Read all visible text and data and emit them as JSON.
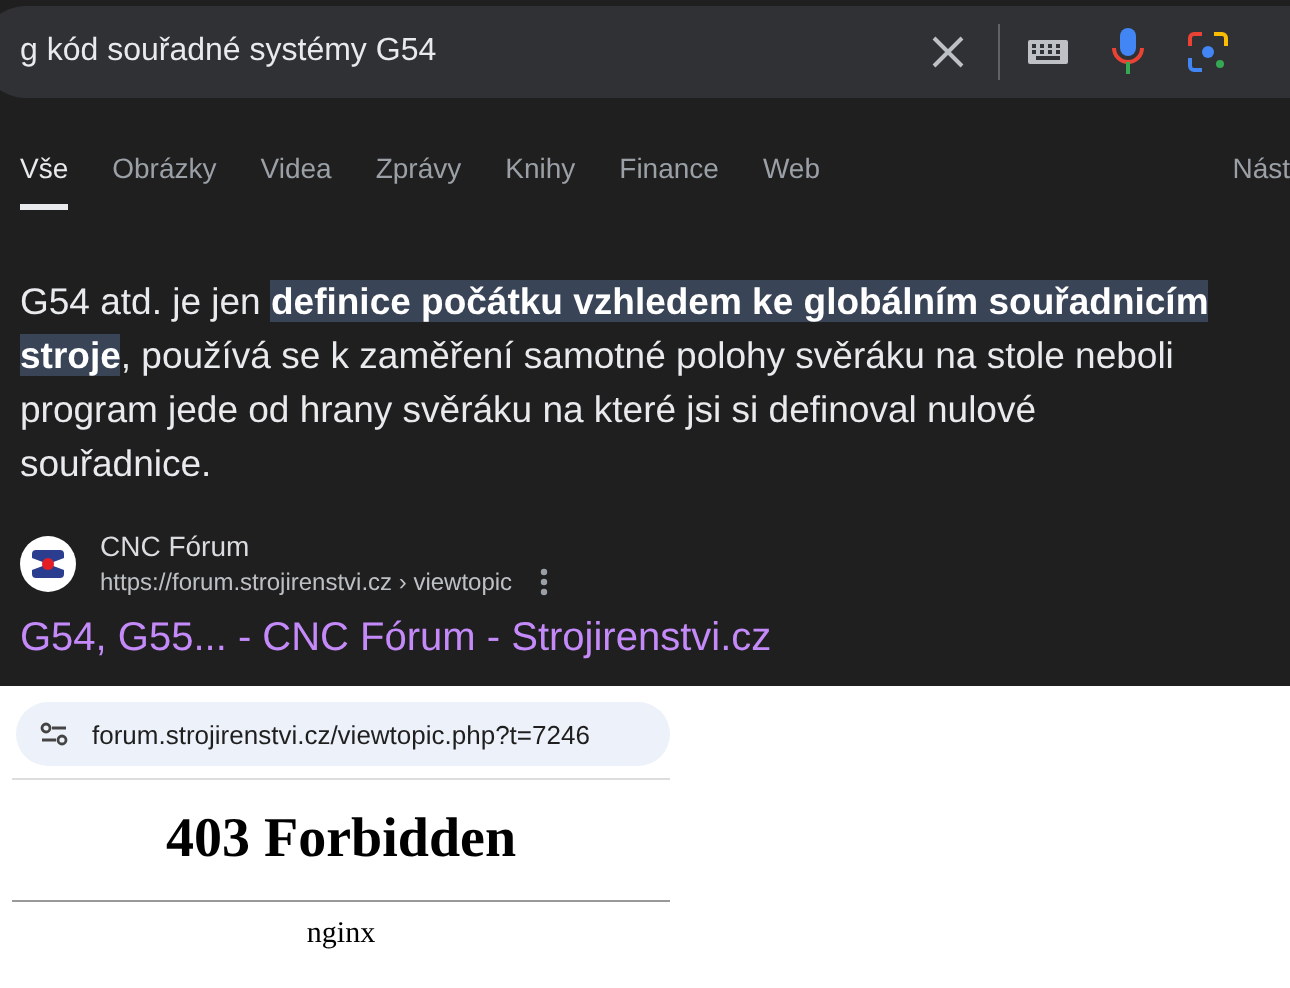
{
  "search": {
    "value": "g kód souřadné systémy G54"
  },
  "tabs": [
    {
      "label": "Vše",
      "selected": true
    },
    {
      "label": "Obrázky",
      "selected": false
    },
    {
      "label": "Videa",
      "selected": false
    },
    {
      "label": "Zprávy",
      "selected": false
    },
    {
      "label": "Knihy",
      "selected": false
    },
    {
      "label": "Finance",
      "selected": false
    },
    {
      "label": "Web",
      "selected": false
    },
    {
      "label": "Nást",
      "selected": false
    }
  ],
  "snippet": "G54 atd. je jen **definice počátku vzhledem ke globálním souřadnicím stroje**, používá se k zaměření samotné polohy svěráku na stole neboli program jede od hrany svěráku na které jsi si definoval nulové souřadnice.",
  "result": {
    "site_name": "CNC Fórum",
    "url": "https://forum.strojirenstvi.cz",
    "breadcrumb": "› viewtopic",
    "title": "G54, G55... - CNC Fórum - Strojirenstvi.cz"
  },
  "browser": {
    "address": "forum.strojirenstvi.cz/viewtopic.php?t=7246",
    "heading": "403 Forbidden",
    "server": "nginx"
  }
}
